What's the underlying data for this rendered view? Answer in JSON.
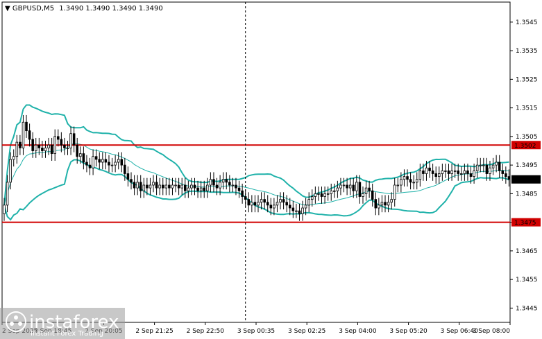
{
  "header": {
    "symbol_tf": "GBPUSD,M5",
    "ohlc": "1.3490 1.3490 1.3490 1.3490"
  },
  "watermark": {
    "brand": "instaforex",
    "tagline": "Instant Forex Trading"
  },
  "colors": {
    "candles": "#000000",
    "bands": "#20b2aa",
    "hlines": "#d10000",
    "price_label": "#000000",
    "background": "#ffffff"
  },
  "chart_data": {
    "type": "candlestick",
    "symbol": "GBPUSD",
    "timeframe": "M5",
    "ylim": [
      1.344,
      1.3552
    ],
    "yticks": [
      "1.3545",
      "1.3535",
      "1.3525",
      "1.3515",
      "1.3505",
      "1.3495",
      "1.3485",
      "1.3475",
      "1.3465",
      "1.3455",
      "1.3445"
    ],
    "xticks": [
      "2 Sep 2025",
      "2 Sep 18:45",
      "2 Sep 20:05",
      "2 Sep 21:25",
      "2 Sep 22:50",
      "3 Sep 00:35",
      "3 Sep 02:25",
      "3 Sep 04:00",
      "3 Sep 05:20",
      "3 Sep 06:40",
      "3 Sep 08:00"
    ],
    "horizontal_lines": [
      {
        "label": "1.3502",
        "value": 1.3502
      },
      {
        "label": "1.3475",
        "value": 1.3475
      }
    ],
    "current_price": {
      "label": "1.3490",
      "value": 1.349
    },
    "separator_index": 76,
    "close": [
      1.3481,
      1.3489,
      1.3497,
      1.3498,
      1.3503,
      1.3501,
      1.351,
      1.3507,
      1.3504,
      1.35,
      1.3502,
      1.3501,
      1.35,
      1.3501,
      1.3502,
      1.3499,
      1.3505,
      1.3504,
      1.3502,
      1.3501,
      1.3501,
      1.3506,
      1.3502,
      1.3498,
      1.3499,
      1.3496,
      1.3495,
      1.3494,
      1.3498,
      1.3497,
      1.3496,
      1.3497,
      1.3496,
      1.3495,
      1.3495,
      1.3496,
      1.3497,
      1.3495,
      1.3492,
      1.349,
      1.3489,
      1.3487,
      1.3489,
      1.3486,
      1.3488,
      1.3487,
      1.3488,
      1.3489,
      1.3487,
      1.3488,
      1.3487,
      1.3488,
      1.3487,
      1.3488,
      1.3488,
      1.3487,
      1.3488,
      1.3486,
      1.3487,
      1.3488,
      1.3487,
      1.3486,
      1.3487,
      1.3486,
      1.3488,
      1.349,
      1.3488,
      1.3487,
      1.3489,
      1.349,
      1.3489,
      1.3488,
      1.3488,
      1.3487,
      1.3486,
      1.3484,
      1.3483,
      1.3481,
      1.3482,
      1.3481,
      1.3482,
      1.3483,
      1.3482,
      1.3481,
      1.348,
      1.3481,
      1.3482,
      1.3483,
      1.3482,
      1.3481,
      1.348,
      1.3479,
      1.3479,
      1.3478,
      1.348,
      1.3481,
      1.3483,
      1.3484,
      1.3485,
      1.3485,
      1.3484,
      1.3485,
      1.3485,
      1.3486,
      1.3486,
      1.3487,
      1.3488,
      1.3488,
      1.3487,
      1.3488,
      1.3486,
      1.3489,
      1.3484,
      1.3485,
      1.3487,
      1.3486,
      1.3483,
      1.348,
      1.3481,
      1.3482,
      1.3481,
      1.3482,
      1.3483,
      1.3488,
      1.3488,
      1.349,
      1.3491,
      1.349,
      1.3489,
      1.3489,
      1.349,
      1.3493,
      1.3492,
      1.3494,
      1.3493,
      1.3492,
      1.3491,
      1.3492,
      1.3493,
      1.3493,
      1.3492,
      1.3493,
      1.3493,
      1.3492,
      1.3492,
      1.3493,
      1.3492,
      1.3491,
      1.3493,
      1.3495,
      1.3495,
      1.3495,
      1.3492,
      1.3494,
      1.3495,
      1.3496,
      1.3493,
      1.3492,
      1.3491,
      1.349
    ]
  }
}
